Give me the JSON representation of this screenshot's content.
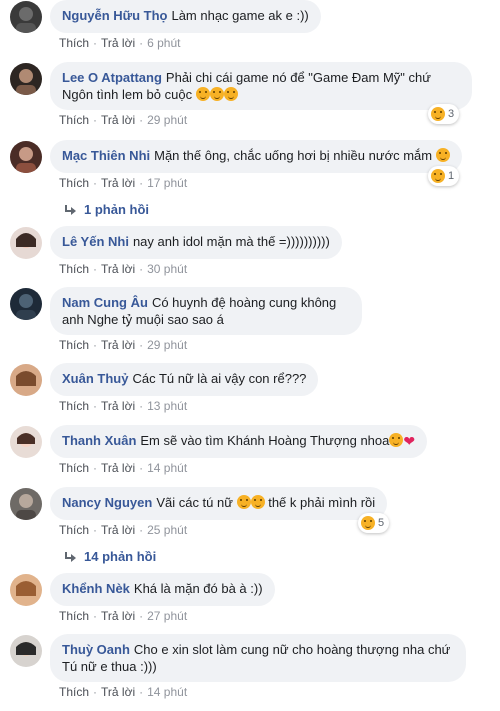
{
  "actions": {
    "like": "Thích",
    "reply": "Trả lời"
  },
  "comments": [
    {
      "author": "Nguyễn Hữu Thọ",
      "text": "Làm nhạc game ak e :))",
      "time": "6 phút"
    },
    {
      "author": "Lee O Atpattang",
      "text": "Phải chi cái game nó để \"Game Đam Mỹ\" chứ Ngôn tình lem bỏ cuộc",
      "time": "29 phút",
      "reaction_count": "3"
    },
    {
      "author": "Mạc Thiên Nhi",
      "text": "Mặn thế ông, chắc uống hơi bị nhiều nước mắm",
      "time": "17 phút",
      "reaction_count": "1",
      "replies": "1 phản hồi"
    },
    {
      "author": "Lê Yến Nhi",
      "text": "nay anh idol mặn mà thế =))))))))))",
      "time": "30 phút"
    },
    {
      "author": "Nam Cung Âu",
      "text": "Có huynh đệ hoàng cung không anh Nghe tỷ muội sao sao á",
      "time": "29 phút"
    },
    {
      "author": "Xuân Thuỷ",
      "text": "Các Tú nữ là ai vậy con rể???",
      "time": "13 phút"
    },
    {
      "author": "Thanh Xuân",
      "text": "Em sẽ vào tìm Khánh Hoàng Thượng nhoa",
      "time": "14 phút"
    },
    {
      "author": "Nancy Nguyen",
      "text": "Vãi các tú nữ",
      "text2": "thế k phải mình rồi",
      "time": "25 phút",
      "reaction_count": "5",
      "replies": "14 phản hồi"
    },
    {
      "author": "Khểnh Nèk",
      "text": "Khá là mặn đó bà à :))",
      "time": "27 phút"
    },
    {
      "author": "Thuỳ Oanh",
      "text": "Cho e xin slot làm cung nữ cho hoàng thượng nha chứ Tú nữ e thua :)))",
      "time": "14 phút"
    }
  ],
  "colors": {
    "author": "#385898",
    "bubble": "#f0f2f5",
    "meta": "#90949c"
  }
}
